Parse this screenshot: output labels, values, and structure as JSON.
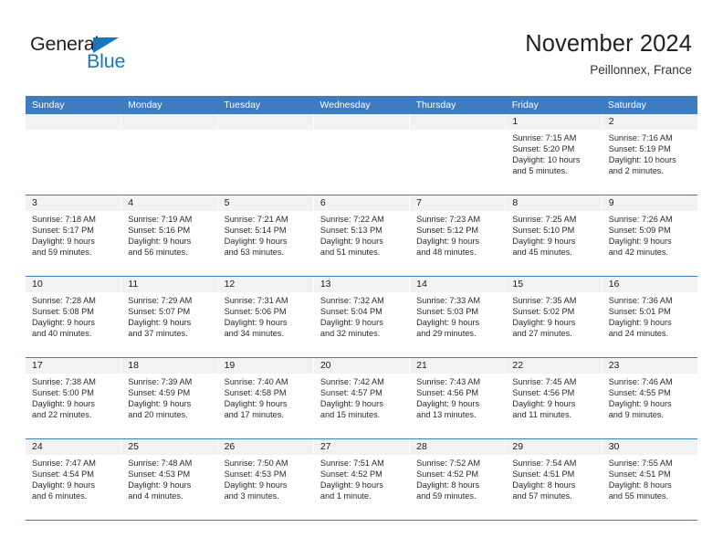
{
  "brand": {
    "name_part1": "General",
    "name_part2": "Blue",
    "accent_color": "#1b75bb",
    "triangle_icon": "triangle-icon"
  },
  "header": {
    "title": "November 2024",
    "subtitle": "Peillonnex, France"
  },
  "calendar": {
    "header_color": "#3e7cbf",
    "daynum_band_color": "#f2f2f2",
    "weekday_headers": [
      "Sunday",
      "Monday",
      "Tuesday",
      "Wednesday",
      "Thursday",
      "Friday",
      "Saturday"
    ],
    "weeks": [
      [
        {
          "day": "",
          "empty": true,
          "sunrise": "",
          "sunset": "",
          "daylight1": "",
          "daylight2": ""
        },
        {
          "day": "",
          "empty": true,
          "sunrise": "",
          "sunset": "",
          "daylight1": "",
          "daylight2": ""
        },
        {
          "day": "",
          "empty": true,
          "sunrise": "",
          "sunset": "",
          "daylight1": "",
          "daylight2": ""
        },
        {
          "day": "",
          "empty": true,
          "sunrise": "",
          "sunset": "",
          "daylight1": "",
          "daylight2": ""
        },
        {
          "day": "",
          "empty": true,
          "sunrise": "",
          "sunset": "",
          "daylight1": "",
          "daylight2": ""
        },
        {
          "day": "1",
          "empty": false,
          "sunrise": "Sunrise: 7:15 AM",
          "sunset": "Sunset: 5:20 PM",
          "daylight1": "Daylight: 10 hours",
          "daylight2": "and 5 minutes."
        },
        {
          "day": "2",
          "empty": false,
          "sunrise": "Sunrise: 7:16 AM",
          "sunset": "Sunset: 5:19 PM",
          "daylight1": "Daylight: 10 hours",
          "daylight2": "and 2 minutes."
        }
      ],
      [
        {
          "day": "3",
          "empty": false,
          "sunrise": "Sunrise: 7:18 AM",
          "sunset": "Sunset: 5:17 PM",
          "daylight1": "Daylight: 9 hours",
          "daylight2": "and 59 minutes."
        },
        {
          "day": "4",
          "empty": false,
          "sunrise": "Sunrise: 7:19 AM",
          "sunset": "Sunset: 5:16 PM",
          "daylight1": "Daylight: 9 hours",
          "daylight2": "and 56 minutes."
        },
        {
          "day": "5",
          "empty": false,
          "sunrise": "Sunrise: 7:21 AM",
          "sunset": "Sunset: 5:14 PM",
          "daylight1": "Daylight: 9 hours",
          "daylight2": "and 53 minutes."
        },
        {
          "day": "6",
          "empty": false,
          "sunrise": "Sunrise: 7:22 AM",
          "sunset": "Sunset: 5:13 PM",
          "daylight1": "Daylight: 9 hours",
          "daylight2": "and 51 minutes."
        },
        {
          "day": "7",
          "empty": false,
          "sunrise": "Sunrise: 7:23 AM",
          "sunset": "Sunset: 5:12 PM",
          "daylight1": "Daylight: 9 hours",
          "daylight2": "and 48 minutes."
        },
        {
          "day": "8",
          "empty": false,
          "sunrise": "Sunrise: 7:25 AM",
          "sunset": "Sunset: 5:10 PM",
          "daylight1": "Daylight: 9 hours",
          "daylight2": "and 45 minutes."
        },
        {
          "day": "9",
          "empty": false,
          "sunrise": "Sunrise: 7:26 AM",
          "sunset": "Sunset: 5:09 PM",
          "daylight1": "Daylight: 9 hours",
          "daylight2": "and 42 minutes."
        }
      ],
      [
        {
          "day": "10",
          "empty": false,
          "sunrise": "Sunrise: 7:28 AM",
          "sunset": "Sunset: 5:08 PM",
          "daylight1": "Daylight: 9 hours",
          "daylight2": "and 40 minutes."
        },
        {
          "day": "11",
          "empty": false,
          "sunrise": "Sunrise: 7:29 AM",
          "sunset": "Sunset: 5:07 PM",
          "daylight1": "Daylight: 9 hours",
          "daylight2": "and 37 minutes."
        },
        {
          "day": "12",
          "empty": false,
          "sunrise": "Sunrise: 7:31 AM",
          "sunset": "Sunset: 5:06 PM",
          "daylight1": "Daylight: 9 hours",
          "daylight2": "and 34 minutes."
        },
        {
          "day": "13",
          "empty": false,
          "sunrise": "Sunrise: 7:32 AM",
          "sunset": "Sunset: 5:04 PM",
          "daylight1": "Daylight: 9 hours",
          "daylight2": "and 32 minutes."
        },
        {
          "day": "14",
          "empty": false,
          "sunrise": "Sunrise: 7:33 AM",
          "sunset": "Sunset: 5:03 PM",
          "daylight1": "Daylight: 9 hours",
          "daylight2": "and 29 minutes."
        },
        {
          "day": "15",
          "empty": false,
          "sunrise": "Sunrise: 7:35 AM",
          "sunset": "Sunset: 5:02 PM",
          "daylight1": "Daylight: 9 hours",
          "daylight2": "and 27 minutes."
        },
        {
          "day": "16",
          "empty": false,
          "sunrise": "Sunrise: 7:36 AM",
          "sunset": "Sunset: 5:01 PM",
          "daylight1": "Daylight: 9 hours",
          "daylight2": "and 24 minutes."
        }
      ],
      [
        {
          "day": "17",
          "empty": false,
          "sunrise": "Sunrise: 7:38 AM",
          "sunset": "Sunset: 5:00 PM",
          "daylight1": "Daylight: 9 hours",
          "daylight2": "and 22 minutes."
        },
        {
          "day": "18",
          "empty": false,
          "sunrise": "Sunrise: 7:39 AM",
          "sunset": "Sunset: 4:59 PM",
          "daylight1": "Daylight: 9 hours",
          "daylight2": "and 20 minutes."
        },
        {
          "day": "19",
          "empty": false,
          "sunrise": "Sunrise: 7:40 AM",
          "sunset": "Sunset: 4:58 PM",
          "daylight1": "Daylight: 9 hours",
          "daylight2": "and 17 minutes."
        },
        {
          "day": "20",
          "empty": false,
          "sunrise": "Sunrise: 7:42 AM",
          "sunset": "Sunset: 4:57 PM",
          "daylight1": "Daylight: 9 hours",
          "daylight2": "and 15 minutes."
        },
        {
          "day": "21",
          "empty": false,
          "sunrise": "Sunrise: 7:43 AM",
          "sunset": "Sunset: 4:56 PM",
          "daylight1": "Daylight: 9 hours",
          "daylight2": "and 13 minutes."
        },
        {
          "day": "22",
          "empty": false,
          "sunrise": "Sunrise: 7:45 AM",
          "sunset": "Sunset: 4:56 PM",
          "daylight1": "Daylight: 9 hours",
          "daylight2": "and 11 minutes."
        },
        {
          "day": "23",
          "empty": false,
          "sunrise": "Sunrise: 7:46 AM",
          "sunset": "Sunset: 4:55 PM",
          "daylight1": "Daylight: 9 hours",
          "daylight2": "and 9 minutes."
        }
      ],
      [
        {
          "day": "24",
          "empty": false,
          "sunrise": "Sunrise: 7:47 AM",
          "sunset": "Sunset: 4:54 PM",
          "daylight1": "Daylight: 9 hours",
          "daylight2": "and 6 minutes."
        },
        {
          "day": "25",
          "empty": false,
          "sunrise": "Sunrise: 7:48 AM",
          "sunset": "Sunset: 4:53 PM",
          "daylight1": "Daylight: 9 hours",
          "daylight2": "and 4 minutes."
        },
        {
          "day": "26",
          "empty": false,
          "sunrise": "Sunrise: 7:50 AM",
          "sunset": "Sunset: 4:53 PM",
          "daylight1": "Daylight: 9 hours",
          "daylight2": "and 3 minutes."
        },
        {
          "day": "27",
          "empty": false,
          "sunrise": "Sunrise: 7:51 AM",
          "sunset": "Sunset: 4:52 PM",
          "daylight1": "Daylight: 9 hours",
          "daylight2": "and 1 minute."
        },
        {
          "day": "28",
          "empty": false,
          "sunrise": "Sunrise: 7:52 AM",
          "sunset": "Sunset: 4:52 PM",
          "daylight1": "Daylight: 8 hours",
          "daylight2": "and 59 minutes."
        },
        {
          "day": "29",
          "empty": false,
          "sunrise": "Sunrise: 7:54 AM",
          "sunset": "Sunset: 4:51 PM",
          "daylight1": "Daylight: 8 hours",
          "daylight2": "and 57 minutes."
        },
        {
          "day": "30",
          "empty": false,
          "sunrise": "Sunrise: 7:55 AM",
          "sunset": "Sunset: 4:51 PM",
          "daylight1": "Daylight: 8 hours",
          "daylight2": "and 55 minutes."
        }
      ]
    ]
  }
}
